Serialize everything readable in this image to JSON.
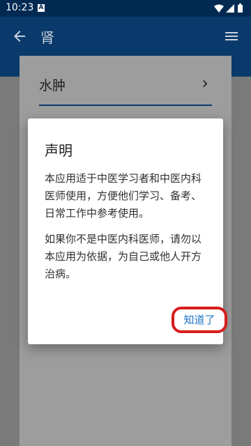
{
  "status_bar": {
    "time": "10:23",
    "notification_letter": "A"
  },
  "app_bar": {
    "title": "肾"
  },
  "list": {
    "items": [
      {
        "label": "水肿"
      }
    ]
  },
  "dialog": {
    "title": "声明",
    "paragraphs": [
      "本应用适于中医学习者和中医内科医师使用，方便他们学习、备考、日常工作中参考使用。",
      "如果你不是中医内科医师，请勿以本应用为依据，为自己或他人开方治病。"
    ],
    "ok_label": "知道了"
  },
  "colors": {
    "status_bar_bg": "#012a52",
    "app_bar_bg": "#0a3a6b",
    "dialog_button": "#1e73c8",
    "highlight_ring": "#d81b1b"
  },
  "icons": [
    "back-arrow-icon",
    "menu-icon",
    "chevron-right-icon",
    "wifi-icon",
    "signal-icon",
    "battery-icon"
  ]
}
